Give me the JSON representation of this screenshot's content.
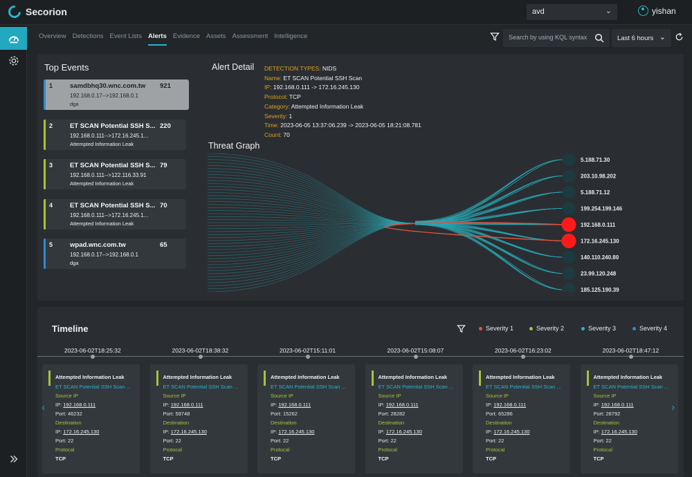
{
  "app": {
    "name": "Secorion"
  },
  "header": {
    "org": "avd",
    "user": "yishan"
  },
  "tabs": [
    {
      "label": "Overview",
      "active": false
    },
    {
      "label": "Detections",
      "active": false
    },
    {
      "label": "Event Lists",
      "active": false
    },
    {
      "label": "Alerts",
      "active": true
    },
    {
      "label": "Evidence",
      "active": false
    },
    {
      "label": "Assets",
      "active": false
    },
    {
      "label": "Assessment",
      "active": false
    },
    {
      "label": "Intelligence",
      "active": false
    }
  ],
  "search": {
    "placeholder": "Search by using KQL syntax"
  },
  "time_range": "Last 6 hours",
  "top_events": {
    "title": "Top Events",
    "items": [
      {
        "rank": "1",
        "name": "samdbhq30.wnc.com.tw",
        "count": "921",
        "ips": "192.168.0.17-->192.168.0.1",
        "category": "dga",
        "color": "#2f8bd0",
        "selected": true
      },
      {
        "rank": "2",
        "name": "ET SCAN Potential SSH S...",
        "count": "220",
        "ips": "192.168.0.111-->172.16.245.1...",
        "category": "Attempted Information Leak",
        "color": "#a8c33a",
        "selected": false
      },
      {
        "rank": "3",
        "name": "ET SCAN Potential SSH S...",
        "count": "79",
        "ips": "192.168.0.111-->122.116.33.91",
        "category": "Attempted Information Leak",
        "color": "#a8c33a",
        "selected": false
      },
      {
        "rank": "4",
        "name": "ET SCAN Potential SSH S...",
        "count": "70",
        "ips": "192.168.0.111-->172.16.245.1...",
        "category": "Attempted Information Leak",
        "color": "#a8c33a",
        "selected": false
      },
      {
        "rank": "5",
        "name": "wpad.wnc.com.tw",
        "count": "65",
        "ips": "192.168.0.17-->192.168.0.1",
        "category": "dga",
        "color": "#2f8bd0",
        "selected": false
      }
    ]
  },
  "alert_detail": {
    "title": "Alert Detail",
    "rows": [
      {
        "key": "DETECTION TYPES: ",
        "value": "NIDS"
      },
      {
        "key": "Name: ",
        "value": "ET SCAN Potential SSH Scan"
      },
      {
        "key": "IP: ",
        "value": "192.168.0.111 -> 172.16.245.130"
      },
      {
        "key": "Protocol: ",
        "value": "TCP"
      },
      {
        "key": "Category: ",
        "value": "Attempted Information Leak"
      },
      {
        "key": "Severity: ",
        "value": "1"
      },
      {
        "key": "Time: ",
        "value": "2023-06-05 13:37:06.239 -> 2023-06-05 18:21:08.781"
      },
      {
        "key": "Count: ",
        "value": "70"
      }
    ]
  },
  "threat_graph": {
    "title": "Threat Graph",
    "nodes": [
      {
        "label": "5.188.71.30",
        "highlight": false
      },
      {
        "label": "203.10.98.202",
        "highlight": false
      },
      {
        "label": "5.188.71.12",
        "highlight": false
      },
      {
        "label": "199.254.199.146",
        "highlight": false
      },
      {
        "label": "192.168.0.111",
        "highlight": true
      },
      {
        "label": "172.16.245.130",
        "highlight": true
      },
      {
        "label": "140.110.240.80",
        "highlight": false
      },
      {
        "label": "23.99.120.248",
        "highlight": false
      },
      {
        "label": "185.125.190.39",
        "highlight": false
      }
    ],
    "node_color": "#1d3a3f",
    "highlight_color": "#ff1a1a",
    "flow_color": "#2aa7b3"
  },
  "timeline": {
    "title": "Timeline",
    "legend": [
      {
        "label": "Severity 1",
        "color": "#e8533a"
      },
      {
        "label": "Severity 2",
        "color": "#a8c33a"
      },
      {
        "label": "Severity 3",
        "color": "#28b5cf"
      },
      {
        "label": "Severity 4",
        "color": "#2f8bd0"
      }
    ],
    "cards": [
      {
        "timestamp": "2023-06-02T18:25:32",
        "category": "Attempted Information Leak",
        "event": "ET SCAN Potential SSH Scan ...",
        "source_label": "Source IP",
        "src_ip": "192.168.0.111",
        "src_port": "46232",
        "dest_label": "Destination",
        "dst_ip": "172.16.245.130",
        "dst_port": "22",
        "protocol_label": "Protocal",
        "protocol": "TCP"
      },
      {
        "timestamp": "2023-06-02T18:38:32",
        "category": "Attempted Information Leak",
        "event": "ET SCAN Potential SSH Scan ...",
        "source_label": "Source IP",
        "src_ip": "192.168.0.111",
        "src_port": "59748",
        "dest_label": "Destination",
        "dst_ip": "172.16.245.130",
        "dst_port": "22",
        "protocol_label": "Protocal",
        "protocol": "TCP"
      },
      {
        "timestamp": "2023-06-02T15:11:01",
        "category": "Attempted Information Leak",
        "event": "ET SCAN Potential SSH Scan ...",
        "source_label": "Source IP",
        "src_ip": "192.168.0.111",
        "src_port": "15262",
        "dest_label": "Destination",
        "dst_ip": "172.16.245.130",
        "dst_port": "22",
        "protocol_label": "Protocal",
        "protocol": "TCP"
      },
      {
        "timestamp": "2023-06-02T15:08:07",
        "category": "Attempted Information Leak",
        "event": "ET SCAN Potential SSH Scan ...",
        "source_label": "Source IP",
        "src_ip": "192.168.0.111",
        "src_port": "28282",
        "dest_label": "Destination",
        "dst_ip": "172.16.245.130",
        "dst_port": "22",
        "protocol_label": "Protocal",
        "protocol": "TCP"
      },
      {
        "timestamp": "2023-06-02T16:23:02",
        "category": "Attempted Information Leak",
        "event": "ET SCAN Potential SSH Scan ...",
        "source_label": "Source IP",
        "src_ip": "192.168.0.111",
        "src_port": "65286",
        "dest_label": "Destination",
        "dst_ip": "172.16.245.130",
        "dst_port": "22",
        "protocol_label": "Protocal",
        "protocol": "TCP"
      },
      {
        "timestamp": "2023-06-02T18:47:12",
        "category": "Attempted Information Leak",
        "event": "ET SCAN Potential SSH Scan ...",
        "source_label": "Source IP",
        "src_ip": "192.168.0.111",
        "src_port": "28792",
        "dest_label": "Destination",
        "dst_ip": "172.16.245.130",
        "dst_port": "22",
        "protocol_label": "Protocal",
        "protocol": "TCP"
      }
    ]
  }
}
